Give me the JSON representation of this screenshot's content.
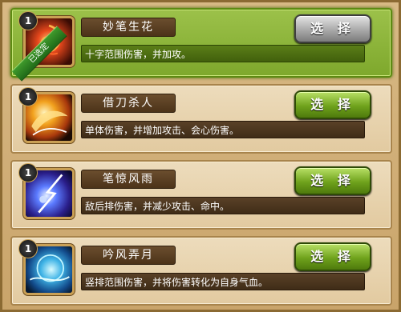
{
  "skills": [
    {
      "level": "1",
      "name": "妙笔生花",
      "description": "十字范围伤害，并加攻。",
      "button_label": "选 择",
      "selected": true,
      "status_ribbon": "已选定",
      "icon": "flame-swirl-icon"
    },
    {
      "level": "1",
      "name": "借刀杀人",
      "description": "单体伤害，并增加攻击、会心伤害。",
      "button_label": "选 择",
      "selected": false,
      "icon": "fire-slash-icon"
    },
    {
      "level": "1",
      "name": "笔惊风雨",
      "description": "敌后排伤害，并减少攻击、命中。",
      "button_label": "选 择",
      "selected": false,
      "icon": "lightning-storm-icon"
    },
    {
      "level": "1",
      "name": "吟风弄月",
      "description": "竖排范围伤害，并将伤害转化为自身气血。",
      "button_label": "选 择",
      "selected": false,
      "icon": "moon-wind-icon"
    }
  ],
  "colors": {
    "selected_card": "#8db63a",
    "card": "#e6d0a8",
    "green_button": "#6fa21c",
    "gray_button": "#a9a9a9"
  }
}
